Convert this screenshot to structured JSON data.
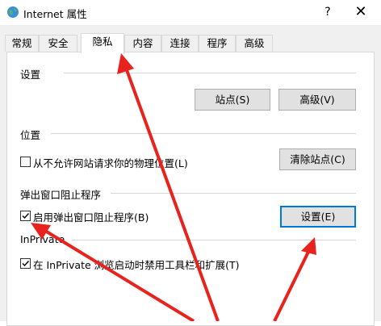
{
  "window": {
    "title": "Internet 属性",
    "help_label": "?",
    "close_label": "✕"
  },
  "tabs": [
    {
      "label": "常规"
    },
    {
      "label": "安全"
    },
    {
      "label": "隐私",
      "active": true
    },
    {
      "label": "内容"
    },
    {
      "label": "连接"
    },
    {
      "label": "程序"
    },
    {
      "label": "高级"
    }
  ],
  "settings_group": {
    "label": "设置",
    "sites_button": "站点(S)",
    "advanced_button": "高级(V)"
  },
  "location_group": {
    "label": "位置",
    "never_allow_checkbox": {
      "label": "从不允许网站请求你的物理位置(L)",
      "checked": false
    },
    "clear_sites_button": "清除站点(C)"
  },
  "popup_group": {
    "label": "弹出窗口阻止程序",
    "enable_checkbox": {
      "label": "启用弹出窗口阻止程序(B)",
      "checked": true
    },
    "settings_button": "设置(E)"
  },
  "inprivate_group": {
    "label": "InPrivate",
    "disable_toolbars_checkbox": {
      "label": "在 InPrivate 浏览启动时禁用工具栏和扩展(T)",
      "checked": true
    }
  },
  "annotation": {
    "arrow_color": "#e8231e",
    "icons": [
      "globe-icon",
      "check-icon",
      "red-arrow"
    ]
  }
}
